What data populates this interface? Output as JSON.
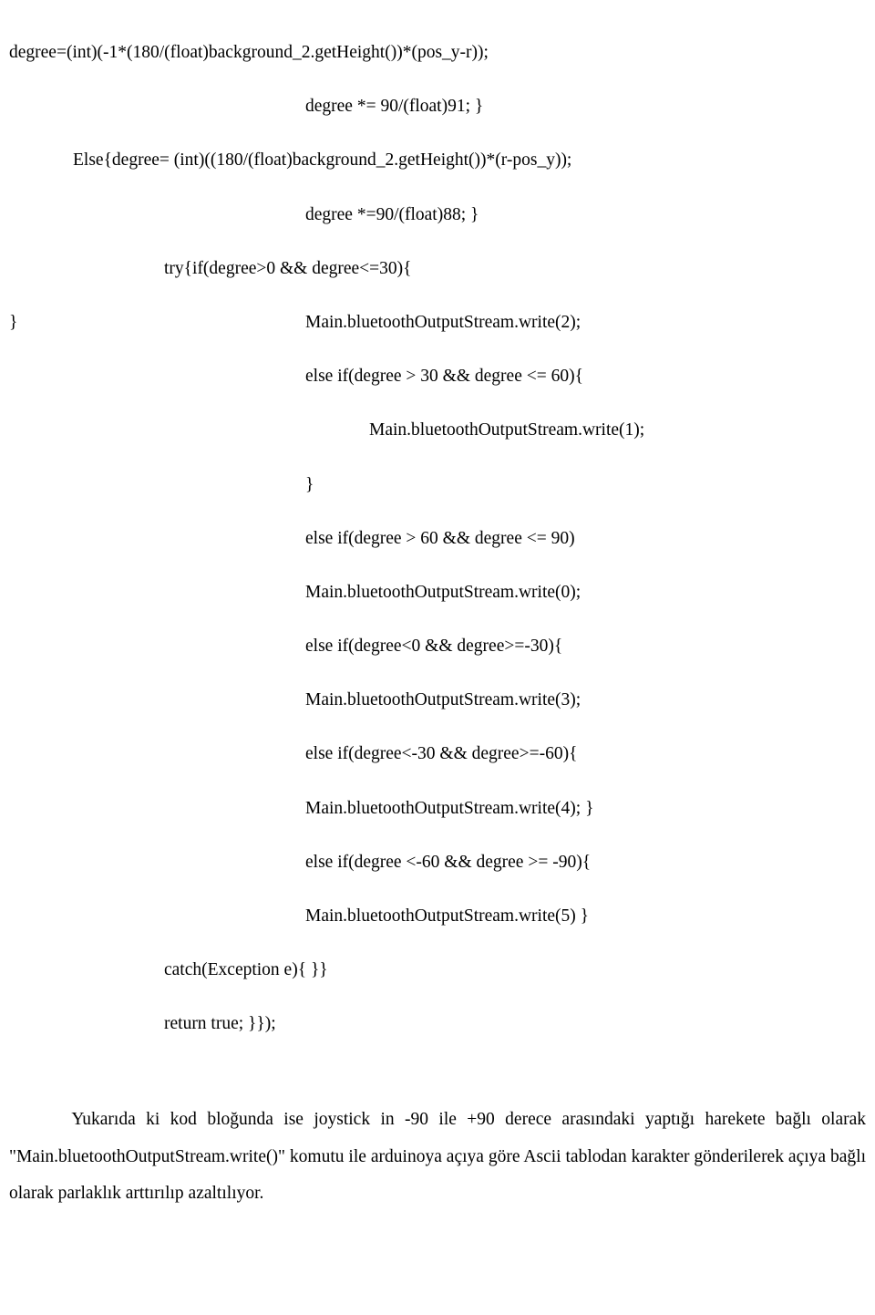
{
  "code": {
    "l1": "degree=(int)(-1*(180/(float)background_2.getHeight())*(pos_y-r));",
    "l2": "degree *= 90/(float)91; }",
    "l3": "Else{degree= (int)((180/(float)background_2.getHeight())*(r-pos_y));",
    "l4": "degree *=90/(float)88; }",
    "l5": "try{if(degree>0 && degree<=30){",
    "l6": "Main.bluetoothOutputStream.write(2);",
    "l6b": "}",
    "l7": "else if(degree > 30 && degree <= 60){",
    "l8": "Main.bluetoothOutputStream.write(1);",
    "l9": "}",
    "l10": "else if(degree > 60 && degree <= 90)",
    "l11": "Main.bluetoothOutputStream.write(0);",
    "l12": "else if(degree<0 && degree>=-30){",
    "l13": "Main.bluetoothOutputStream.write(3);",
    "l14": "else if(degree<-30 && degree>=-60){",
    "l15": "Main.bluetoothOutputStream.write(4); }",
    "l16": "else if(degree <-60 && degree >= -90){",
    "l17": "Main.bluetoothOutputStream.write(5) }",
    "l18": "catch(Exception e){ }}",
    "l19": "return true; }});"
  },
  "paragraph": "Yukarıda ki kod bloğunda ise joystick in -90 ile +90 derece arasındaki yaptığı harekete bağlı olarak \"Main.bluetoothOutputStream.write()\" komutu ile arduinoya açıya göre Ascii tablodan karakter gönderilerek açıya bağlı olarak parlaklık arttırılıp azaltılıyor."
}
